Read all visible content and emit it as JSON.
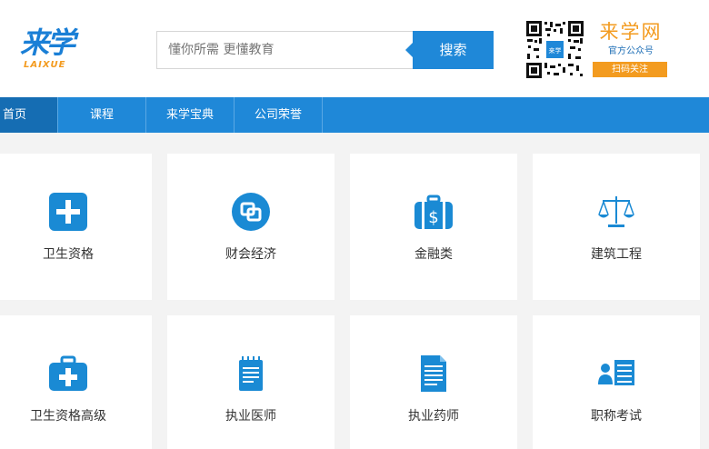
{
  "logo": {
    "main": "来学",
    "sub": "LAIXUE"
  },
  "search": {
    "placeholder": "懂你所需 更懂教育",
    "button_label": "搜索"
  },
  "brand": {
    "name": "来学网",
    "subtitle": "官方公众号",
    "follow_label": "扫码关注",
    "qr_center": "来学"
  },
  "nav": {
    "items": [
      {
        "label": "首页",
        "active": true
      },
      {
        "label": "课程",
        "active": false
      },
      {
        "label": "来学宝典",
        "active": false
      },
      {
        "label": "公司荣誉",
        "active": false
      }
    ]
  },
  "categories": [
    {
      "label": "卫生资格",
      "icon": "medical-cross-icon"
    },
    {
      "label": "财会经济",
      "icon": "link-squares-icon"
    },
    {
      "label": "金融类",
      "icon": "money-bag-icon"
    },
    {
      "label": "建筑工程",
      "icon": "balance-scale-icon"
    },
    {
      "label": "卫生资格高级",
      "icon": "medical-kit-icon"
    },
    {
      "label": "执业医师",
      "icon": "notepad-icon"
    },
    {
      "label": "执业药师",
      "icon": "document-icon"
    },
    {
      "label": "职称考试",
      "icon": "person-list-icon"
    }
  ],
  "colors": {
    "accent": "#1f88d8",
    "orange": "#f39b1f",
    "icon_blue": "#1a8ad4"
  }
}
